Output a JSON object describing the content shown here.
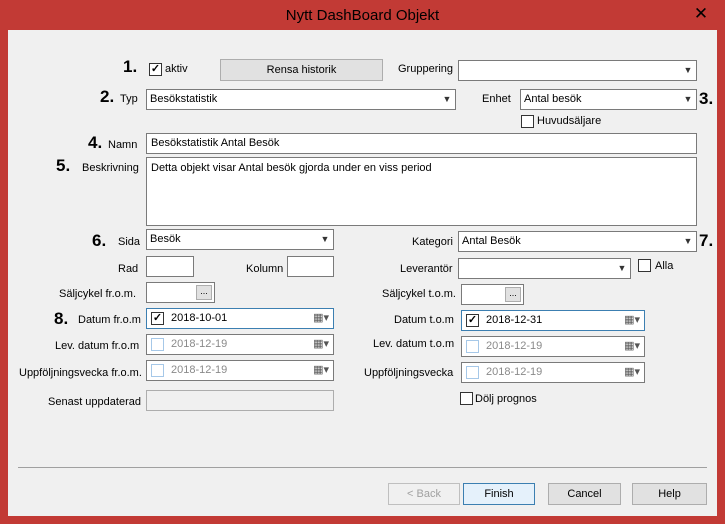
{
  "window": {
    "title": "Nytt DashBoard Objekt",
    "close_glyph": "✕"
  },
  "markers": [
    "1.",
    "2.",
    "3.",
    "4.",
    "5.",
    "6.",
    "7.",
    "8."
  ],
  "aktiv": {
    "label": "aktiv",
    "checked": true
  },
  "rensa_historik": "Rensa historik",
  "gruppering": {
    "label": "Gruppering",
    "value": ""
  },
  "typ": {
    "label": "Typ",
    "value": "Besökstatistik"
  },
  "enhet": {
    "label": "Enhet",
    "value": "Antal besök"
  },
  "huvudsaljare": {
    "label": "Huvudsäljare",
    "checked": false
  },
  "namn": {
    "label": "Namn",
    "value": "Besökstatistik Antal Besök"
  },
  "beskrivning": {
    "label": "Beskrivning",
    "value": "Detta objekt visar Antal besök gjorda under en viss period"
  },
  "sida": {
    "label": "Sida",
    "value": "Besök"
  },
  "kategori": {
    "label": "Kategori",
    "value": "Antal Besök"
  },
  "rad": {
    "label": "Rad",
    "value": ""
  },
  "kolumn": {
    "label": "Kolumn",
    "value": ""
  },
  "leverantor": {
    "label": "Leverantör",
    "value": ""
  },
  "alla": {
    "label": "Alla",
    "checked": false
  },
  "saljcykel_from": {
    "label": "Säljcykel fr.o.m.",
    "button": "..."
  },
  "saljcykel_tom": {
    "label": "Säljcykel t.o.m.",
    "button": "..."
  },
  "datum_from": {
    "label": "Datum fr.o.m",
    "value": "2018-10-01",
    "checked": true
  },
  "datum_tom": {
    "label": "Datum t.o.m",
    "value": "2018-12-31",
    "checked": true
  },
  "lev_datum_from": {
    "label": "Lev. datum fr.o.m",
    "value": "2018-12-19",
    "checked": false
  },
  "lev_datum_tom": {
    "label": "Lev. datum t.o.m",
    "value": "2018-12-19",
    "checked": false
  },
  "uppf_vecka_from": {
    "label": "Uppföljningsvecka fr.o.m.",
    "value": "2018-12-19",
    "checked": false
  },
  "uppf_vecka": {
    "label": "Uppföljningsvecka",
    "value": "2018-12-19",
    "checked": false
  },
  "senast_uppdaterad": {
    "label": "Senast uppdaterad",
    "value": ""
  },
  "dolj_prognos": {
    "label": "Dölj prognos",
    "checked": false
  },
  "footer": {
    "back": "< Back",
    "finish": "Finish",
    "cancel": "Cancel",
    "help": "Help"
  },
  "glyphs": {
    "dropdown": "▼",
    "calendar": "▦▾"
  }
}
